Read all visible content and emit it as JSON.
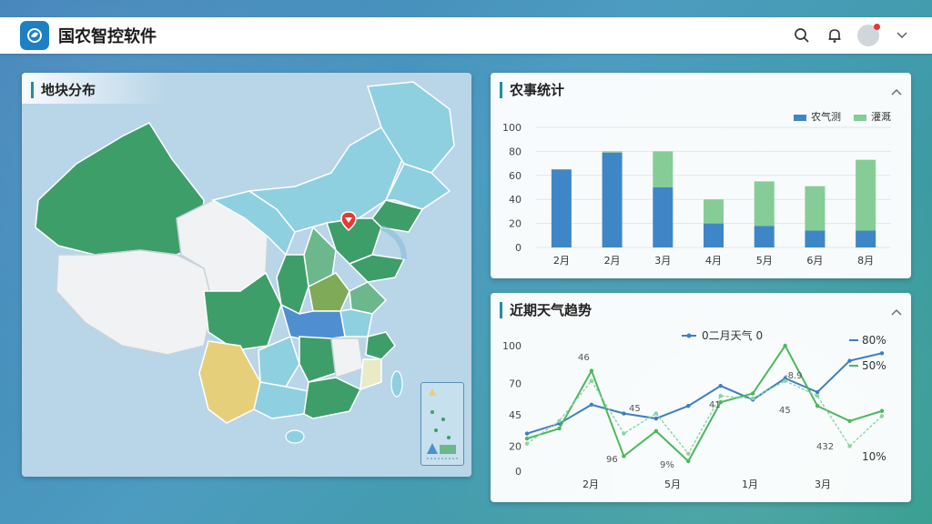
{
  "app": {
    "title": "国农智控软件"
  },
  "header": {
    "icons": [
      "search-icon",
      "bell-icon",
      "avatar",
      "chevron-down-icon"
    ]
  },
  "map_panel": {
    "title": "地块分布",
    "marker": "location-pin-icon",
    "colors": {
      "dark_green": "#3e9e6a",
      "light_green": "#6cb78c",
      "light_blue": "#8fd0e0",
      "white": "#f0f2f3",
      "yellow": "#e6cf7a",
      "blue": "#4f8fd0",
      "olive": "#7faa58"
    }
  },
  "stats_panel": {
    "title": "农事统计",
    "legend": [
      {
        "name": "农气测",
        "color": "#3f86c6"
      },
      {
        "name": "灌溉",
        "color": "#86cc96"
      }
    ],
    "chart_data": {
      "type": "bar",
      "categories": [
        "2月",
        "2月",
        "3月",
        "4月",
        "5月",
        "6月",
        "8月"
      ],
      "series": [
        {
          "name": "农气测",
          "values": [
            65,
            79,
            50,
            20,
            18,
            14,
            14
          ]
        },
        {
          "name": "灌溉",
          "values": [
            0,
            1,
            30,
            20,
            37,
            37,
            59
          ]
        }
      ],
      "ylim": [
        0,
        100
      ],
      "yticks": [
        0,
        20,
        40,
        60,
        80,
        100
      ],
      "grid": true,
      "legend_position": "top-right"
    }
  },
  "trend_panel": {
    "title": "近期天气趋势",
    "chart_data": {
      "type": "line",
      "legend_title": "0二月天气 0",
      "categories": [
        "2月",
        "5月",
        "1月",
        "3月"
      ],
      "yticks": [
        0,
        20,
        45,
        70,
        100
      ],
      "right_labels": [
        "80%",
        "50%",
        "10%"
      ],
      "ylim": [
        0,
        100
      ],
      "series": [
        {
          "name": "80%",
          "color": "#3f7fc0",
          "values": [
            30,
            38,
            53,
            46,
            42,
            52,
            68,
            57,
            74,
            63,
            88,
            94
          ]
        },
        {
          "name": "50%",
          "color": "#4cb85c",
          "values": [
            26,
            34,
            80,
            12,
            32,
            8,
            55,
            62,
            102,
            52,
            40,
            48
          ]
        },
        {
          "name": "",
          "color": "#8fd0a8",
          "values": [
            22,
            40,
            72,
            30,
            46,
            14,
            60,
            58,
            72,
            60,
            20,
            44
          ]
        }
      ],
      "annotations": [
        "46",
        "45",
        "41",
        "-8.9",
        "45",
        "96",
        "9%",
        "432"
      ]
    }
  }
}
